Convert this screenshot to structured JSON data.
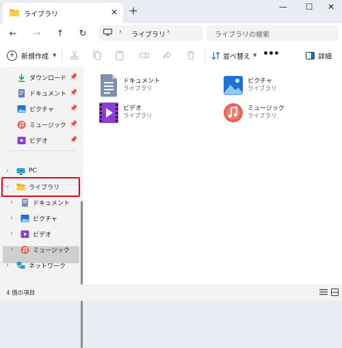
{
  "tab": {
    "title": "ライブラリ",
    "close": "✕",
    "new_tab": "+"
  },
  "window_controls": {
    "minimize": "—",
    "maximize": "☐",
    "close": "✕"
  },
  "nav": {
    "back": "←",
    "forward": "→",
    "up": "↑",
    "refresh": "↻"
  },
  "address": {
    "separator": "›",
    "path": "ライブラリ",
    "trailing": "›"
  },
  "search": {
    "placeholder": "ライブラリの検索"
  },
  "command_bar": {
    "new_label": "新規作成",
    "sort_label": "並べ替え",
    "more": "•••",
    "details_label": "詳細"
  },
  "sidebar": {
    "quick_access": [
      {
        "label": "ダウンロード",
        "icon": "download-icon",
        "pinned": true
      },
      {
        "label": "ドキュメント",
        "icon": "document-icon",
        "pinned": true
      },
      {
        "label": "ピクチャ",
        "icon": "picture-icon",
        "pinned": true
      },
      {
        "label": "ミュージック",
        "icon": "music-icon",
        "pinned": true
      },
      {
        "label": "ビデオ",
        "icon": "video-icon",
        "pinned": true
      }
    ],
    "tree": {
      "pc": "PC",
      "libraries": "ライブラリ",
      "lib_documents": "ドキュメント",
      "lib_pictures": "ピクチャ",
      "lib_videos": "ビデオ",
      "lib_music": "ミュージック",
      "network": "ネットワーク"
    }
  },
  "content": {
    "items": [
      {
        "name": "ドキュメント",
        "type": "ライブラリ",
        "icon": "documents-library-icon"
      },
      {
        "name": "ピクチャ",
        "type": "ライブラリ",
        "icon": "pictures-library-icon"
      },
      {
        "name": "ビデオ",
        "type": "ライブラリ",
        "icon": "videos-library-icon"
      },
      {
        "name": "ミュージック",
        "type": "ライブラリ",
        "icon": "music-library-icon"
      }
    ]
  },
  "status": {
    "item_count": "4 個の項目"
  },
  "colors": {
    "highlight_border": "#e6001e",
    "selected_bg": "#cfcfcf",
    "accent": "#0067c0"
  }
}
